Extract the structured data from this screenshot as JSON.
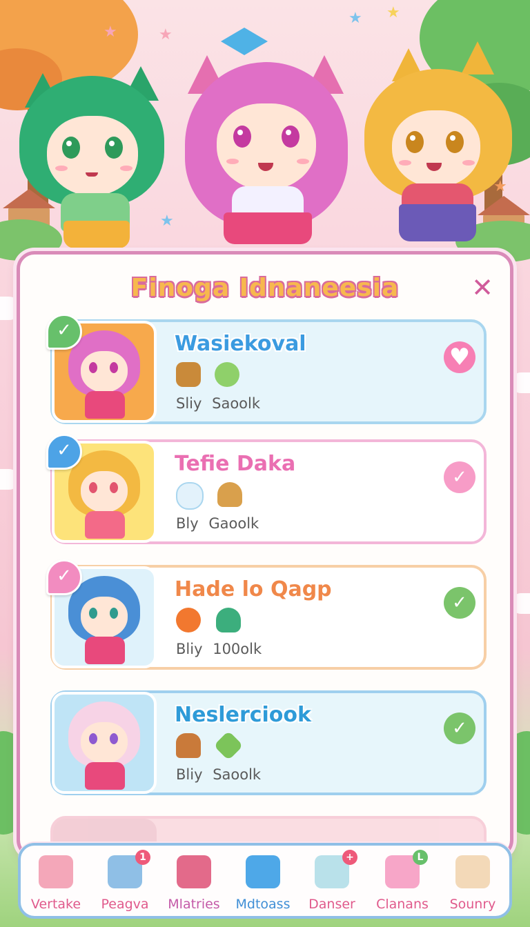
{
  "dialog": {
    "title": "Finoga Idnaneesia",
    "close_glyph": "✕"
  },
  "cards": [
    {
      "name": "Wasiekoval",
      "name_color": "#3b9be0",
      "border_color": "#a9d6ef",
      "bg_color": "#e6f5fb",
      "thumb_bg": "#f7a94c",
      "badge_color": "#67c06b",
      "badge_glyph": "✓",
      "items": [
        "coffee-cup-icon",
        "green-slime-icon"
      ],
      "stats": [
        "Sliy",
        "Saoolk"
      ],
      "status_glyph": "♥",
      "status_color": "#f77fb4"
    },
    {
      "name": "Tefie Daka",
      "name_color": "#ea6fb2",
      "border_color": "#f3b6d8",
      "bg_color": "#ffffff",
      "thumb_bg": "#fde37a",
      "badge_color": "#4da3e6",
      "badge_glyph": "✓",
      "items": [
        "cloud-icon",
        "ice-cream-icon"
      ],
      "stats": [
        "Bly",
        "Gaoolk"
      ],
      "status_glyph": "✓",
      "status_color": "#f79cc7"
    },
    {
      "name": "Hade lo Qagp",
      "name_color": "#f0884a",
      "border_color": "#f7cfa6",
      "bg_color": "#ffffff",
      "thumb_bg": "#dff2fb",
      "badge_color": "#f28cc0",
      "badge_glyph": "✓",
      "items": [
        "orange-slime-icon",
        "green-sprout-icon"
      ],
      "stats": [
        "Bliy",
        "100olk"
      ],
      "status_glyph": "✓",
      "status_color": "#7bc46b"
    },
    {
      "name": "Neslerciook",
      "name_color": "#2f9bd8",
      "border_color": "#9fcfee",
      "bg_color": "#e7f6fb",
      "thumb_bg": "#bfe4f6",
      "badge_color": "",
      "badge_glyph": "",
      "items": [
        "muffin-icon",
        "green-gem-icon"
      ],
      "stats": [
        "Bliy",
        "Saoolk"
      ],
      "status_glyph": "✓",
      "status_color": "#7bc46b"
    }
  ],
  "nav": [
    {
      "label": "Vertake",
      "color": "#e05a8c",
      "icon": "house-icon",
      "icon_color": "#f4a7b9",
      "badge": "",
      "badge_color": ""
    },
    {
      "label": "Peagva",
      "color": "#e05a8c",
      "icon": "book-icon",
      "icon_color": "#8fbfe6",
      "badge": "1",
      "badge_color": "#ee5a7a"
    },
    {
      "label": "Mlatries",
      "color": "#c45aa8",
      "icon": "pencil-icon",
      "icon_color": "#e36a8a",
      "badge": "",
      "badge_color": ""
    },
    {
      "label": "Mdtoass",
      "color": "#3f8fd6",
      "icon": "list-icon",
      "icon_color": "#4ea8e8",
      "badge": "",
      "badge_color": ""
    },
    {
      "label": "Danser",
      "color": "#e05a8c",
      "icon": "dancer-icon",
      "icon_color": "#b9e1ea",
      "badge": "+",
      "badge_color": "#ee5a7a"
    },
    {
      "label": "Clanans",
      "color": "#e05a8c",
      "icon": "clan-icon",
      "icon_color": "#f7a6c8",
      "badge": "L",
      "badge_color": "#67c06b"
    },
    {
      "label": "Sounry",
      "color": "#e05a8c",
      "icon": "avatar-icon",
      "icon_color": "#f3d9b8",
      "badge": "",
      "badge_color": ""
    }
  ]
}
